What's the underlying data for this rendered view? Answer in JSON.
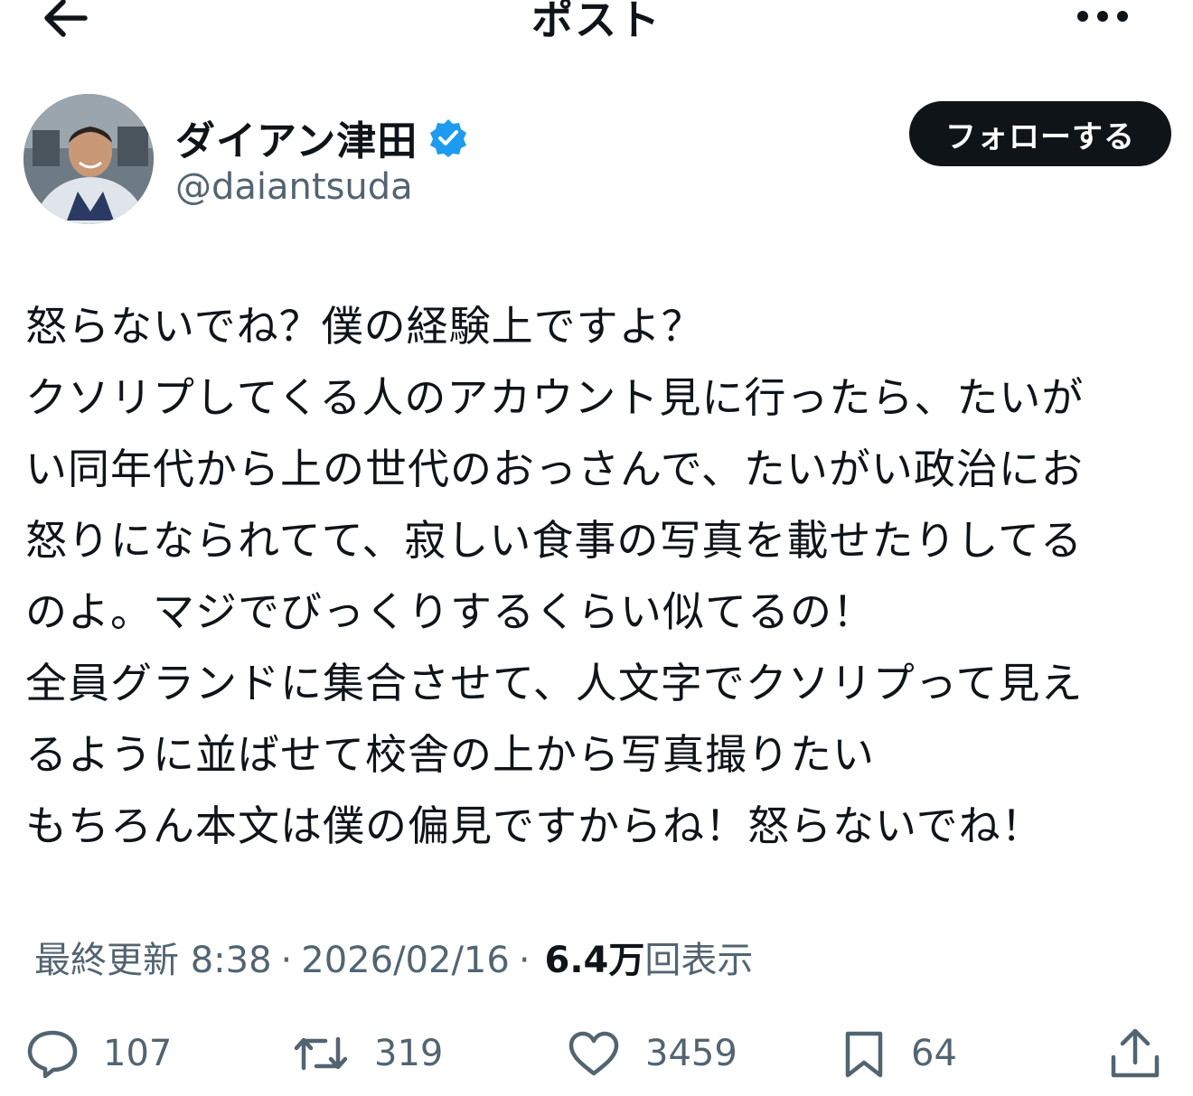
{
  "header": {
    "title": "ポスト"
  },
  "author": {
    "display_name": "ダイアン津田",
    "handle": "@daiantsuda",
    "follow_label": "フォローする"
  },
  "tweet": {
    "lines": [
      "怒らないでね？僕の経験上ですよ？",
      "クソリプしてくる人のアカウント見に行ったら、たいが",
      "い同年代から上の世代のおっさんで、たいがい政治にお",
      "怒りになられてて、寂しい食事の写真を載せたりしてる",
      "のよ。マジでびっくりするくらい似てるの！",
      "全員グランドに集合させて、人文字でクソリプって見え",
      "るように並ばせて校舎の上から写真撮りたい",
      "もちろん本文は僕の偏見ですからね！怒らないでね！"
    ]
  },
  "meta": {
    "updated_label": "最終更新 8:38",
    "separator": "·",
    "date": "2026/02/16",
    "views_count": "6.4万",
    "views_label": "回表示"
  },
  "actions": {
    "reply_count": "107",
    "repost_count": "319",
    "like_count": "3459",
    "bookmark_count": "64"
  },
  "icons": {
    "back": "arrow-left-icon",
    "more": "more-horizontal-icon",
    "verified": "verified-badge-icon",
    "reply": "speech-bubble-icon",
    "repost": "repost-arrows-icon",
    "like": "heart-icon",
    "bookmark": "bookmark-icon",
    "share": "share-upload-icon"
  },
  "colors": {
    "text": "#0f1419",
    "muted": "#536471",
    "verified_blue": "#1d9bf0",
    "follow_button_bg": "#0f1419"
  }
}
